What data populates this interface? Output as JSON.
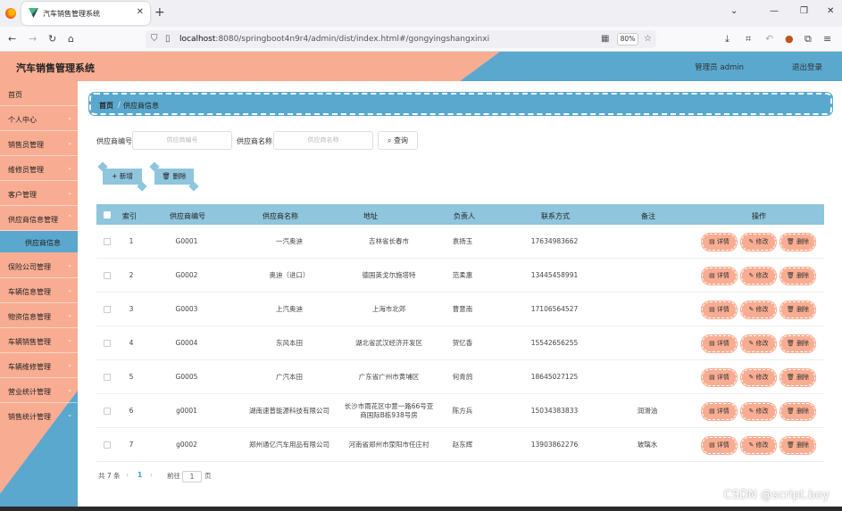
{
  "browser": {
    "tab_title": "汽车销售管理系统",
    "url_host": "localhost",
    "url_rest": ":8080/springboot4n9r4/admin/dist/index.html#/gongyingshangxinxi",
    "zoom": "80%"
  },
  "header": {
    "title": "汽车销售管理系统",
    "admin_label": "管理员 admin",
    "logout_label": "退出登录"
  },
  "sidebar": {
    "items": [
      {
        "label": "首页"
      },
      {
        "label": "个人中心"
      },
      {
        "label": "销售员管理"
      },
      {
        "label": "维修员管理"
      },
      {
        "label": "客户管理"
      },
      {
        "label": "供应商信息管理"
      },
      {
        "label": "供应商信息"
      },
      {
        "label": "保险公司管理"
      },
      {
        "label": "车辆信息管理"
      },
      {
        "label": "物资信息管理"
      },
      {
        "label": "车辆销售管理"
      },
      {
        "label": "车辆维修管理"
      },
      {
        "label": "营业统计管理"
      },
      {
        "label": "销售统计管理"
      }
    ]
  },
  "breadcrumb": {
    "home": "首页",
    "separator": "/",
    "current": "供应商信息"
  },
  "search": {
    "code_label": "供应商编号",
    "code_placeholder": "供应商编号",
    "name_label": "供应商名称",
    "name_placeholder": "供应商名称",
    "button": "查询"
  },
  "actions": {
    "add": "新增",
    "delete": "删除"
  },
  "table": {
    "headers": [
      "索引",
      "供应商编号",
      "供应商名称",
      "地址",
      "负责人",
      "联系方式",
      "备注",
      "操作"
    ],
    "rows": [
      {
        "index": "1",
        "code": "G0001",
        "name": "一汽奥迪",
        "address": "吉林省长春市",
        "owner": "袁扬玉",
        "phone": "17634983662",
        "note": ""
      },
      {
        "index": "2",
        "code": "G0002",
        "name": "奥迪（进口）",
        "address": "德国英戈尔施塔特",
        "owner": "范柔惠",
        "phone": "13445458991",
        "note": ""
      },
      {
        "index": "3",
        "code": "G0003",
        "name": "上汽奥迪",
        "address": "上海市北郊",
        "owner": "曹意南",
        "phone": "17106564527",
        "note": ""
      },
      {
        "index": "4",
        "code": "G0004",
        "name": "东风本田",
        "address": "湖北省武汉经济开发区",
        "owner": "贺忆香",
        "phone": "15542656255",
        "note": ""
      },
      {
        "index": "5",
        "code": "G0005",
        "name": "广汽本田",
        "address": "广东省广州市黄埔区",
        "owner": "何青鸽",
        "phone": "18645027125",
        "note": ""
      },
      {
        "index": "6",
        "code": "g0001",
        "name": "湖南速普能源科技有限公司",
        "address_line1": "长沙市雨花区中意一路66号亚",
        "address_line2": "商国际B栋938号房",
        "owner": "陈方兵",
        "phone": "15034383833",
        "note": "润滑油"
      },
      {
        "index": "7",
        "code": "g0002",
        "name": "郑州通亿汽车用品有限公司",
        "address": "河南省郑州市荥阳市任庄村",
        "owner": "赵东辉",
        "phone": "13903862276",
        "note": "玻璃水"
      }
    ],
    "op_detail": "详情",
    "op_edit": "修改",
    "op_delete": "删除"
  },
  "pager": {
    "total": "共 7 条",
    "prev": "‹",
    "page": "1",
    "next": "›",
    "goto_label": "前往",
    "goto_value": "1",
    "page_suffix": "页"
  },
  "watermark": "CSDN @script.boy"
}
